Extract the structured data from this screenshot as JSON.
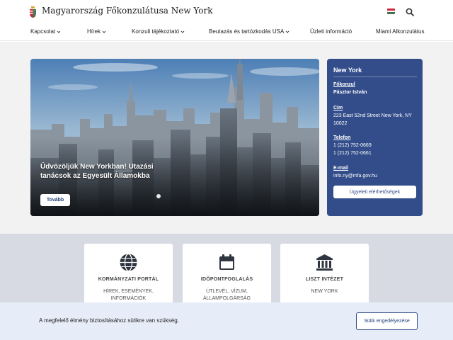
{
  "header": {
    "title": "Magyarország Főkonzulátusa New York",
    "logo_icon": "hungarian-coat-of-arms-icon",
    "search_icon": "search-icon",
    "flag_colors": [
      "#cd2a3e",
      "#ffffff",
      "#436f4d"
    ]
  },
  "nav": {
    "items": [
      {
        "label": "Kapcsolat",
        "dropdown": true
      },
      {
        "label": "Hírek",
        "dropdown": true
      },
      {
        "label": "Konzuli tájékoztató",
        "dropdown": true
      },
      {
        "label": "Beutazás és tartózkodás USA",
        "dropdown": true
      },
      {
        "label": "Üzleti információ",
        "dropdown": false
      },
      {
        "label": "Miami Alkonzulátus",
        "dropdown": false
      }
    ]
  },
  "hero": {
    "headline": "Üdvözöljük New Yorkban! Utazási tanácsok az Egyesült Államokba",
    "button_label": "Tovább"
  },
  "info_card": {
    "title": "New York",
    "consul_label": "Főkonzul",
    "consul_name": "Pásztor István",
    "address_label": "Cím",
    "address": "223 East 52nd Street New York, NY 10022",
    "phone_label": "Telefon",
    "phone_1": "1 (212) 752-0669",
    "phone_2": "1 (212) 752-0661",
    "email_label": "E-mail",
    "email": "info.ny@mfa.gov.hu",
    "button_label": "Ügyeleti elérhetőségek",
    "background_color": "#324d8a"
  },
  "tiles": [
    {
      "icon": "globe-icon",
      "title": "KORMÁNYZATI PORTÁL",
      "subtitle": "HÍREK, ESEMÉNYEK, INFORMÁCIÓK"
    },
    {
      "icon": "calendar-icon",
      "title": "IDŐPONTFOGLALÁS",
      "subtitle": "ÚTLEVÉL, VÍZUM, ÁLLAMPOLGÁRSÁG"
    },
    {
      "icon": "institution-icon",
      "title": "LISZT INTÉZET",
      "subtitle": "NEW YORK"
    }
  ],
  "cookie": {
    "text": "A megfelelő élmény biztosításához sütikre van szükség.",
    "button_label": "Sütik engedélyezése"
  }
}
